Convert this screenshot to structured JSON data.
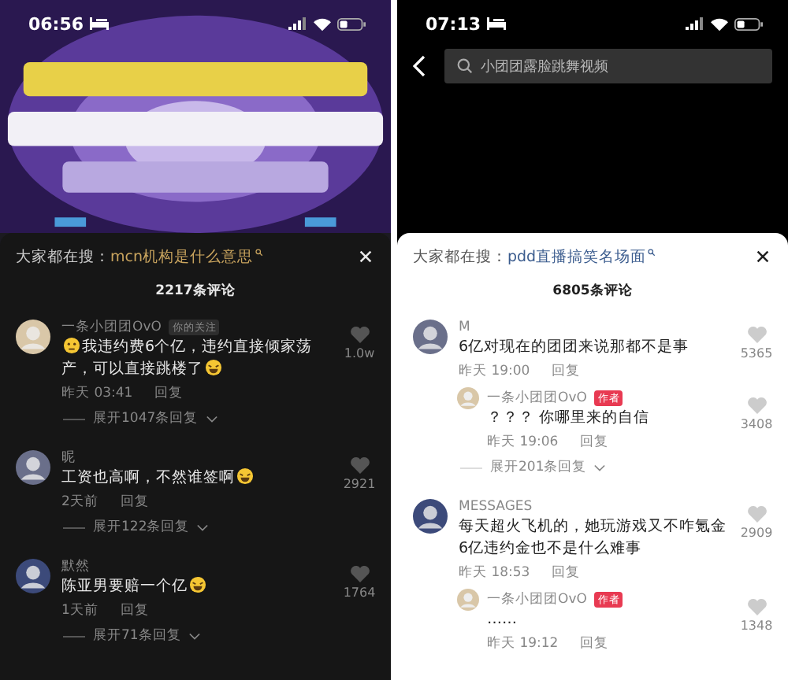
{
  "panels": [
    {
      "status": {
        "time": "06:56"
      },
      "header": {
        "kind": "video"
      },
      "sheet": {
        "hint_label": "大家都在搜：",
        "hint": "mcn机构是什么意思",
        "count": "2217条评论",
        "comments": [
          {
            "user": "一条小团团OvO",
            "tag": {
              "text": "你的关注",
              "kind": "follow"
            },
            "lead_emoji": true,
            "text": "我违约费6个亿，违约直接倾家荡产，可以直接跳楼了",
            "trail_emoji": true,
            "time": "昨天 03:41",
            "reply": "回复",
            "likes": "1.0w",
            "expand": "展开1047条回复"
          },
          {
            "user": "昵",
            "text": "工资也高啊，不然谁签啊",
            "trail_emoji": true,
            "time": "2天前",
            "reply": "回复",
            "likes": "2921",
            "expand": "展开122条回复"
          },
          {
            "user": "默然",
            "text": "陈亚男要赔一个亿",
            "trail_emoji": true,
            "time": "1天前",
            "reply": "回复",
            "likes": "1764",
            "expand": "展开71条回复"
          }
        ]
      }
    },
    {
      "status": {
        "time": "07:13"
      },
      "header": {
        "kind": "search",
        "placeholder": "小团团露脸跳舞视频"
      },
      "sheet": {
        "hint_label": "大家都在搜：",
        "hint": "pdd直播搞笑名场面",
        "count": "6805条评论",
        "comments": [
          {
            "user": "M",
            "text": "6亿对现在的团团来说那都不是事",
            "time": "昨天 19:00",
            "reply": "回复",
            "likes": "5365",
            "replies": [
              {
                "user": "一条小团团OvO",
                "tag": {
                  "text": "作者",
                  "kind": "author"
                },
                "text": "？？？ 你哪里来的自信",
                "time": "昨天 19:06",
                "reply": "回复",
                "likes": "3408"
              }
            ],
            "expand": "展开201条回复"
          },
          {
            "user": "MESSAGES",
            "text": "每天超火飞机的，她玩游戏又不咋氪金6亿违约金也不是什么难事",
            "time": "昨天 18:53",
            "reply": "回复",
            "likes": "2909",
            "replies": [
              {
                "user": "一条小团团OvO",
                "tag": {
                  "text": "作者",
                  "kind": "author"
                },
                "text": "……",
                "time": "昨天 19:12",
                "reply": "回复",
                "likes": "1348"
              }
            ]
          }
        ]
      }
    }
  ]
}
